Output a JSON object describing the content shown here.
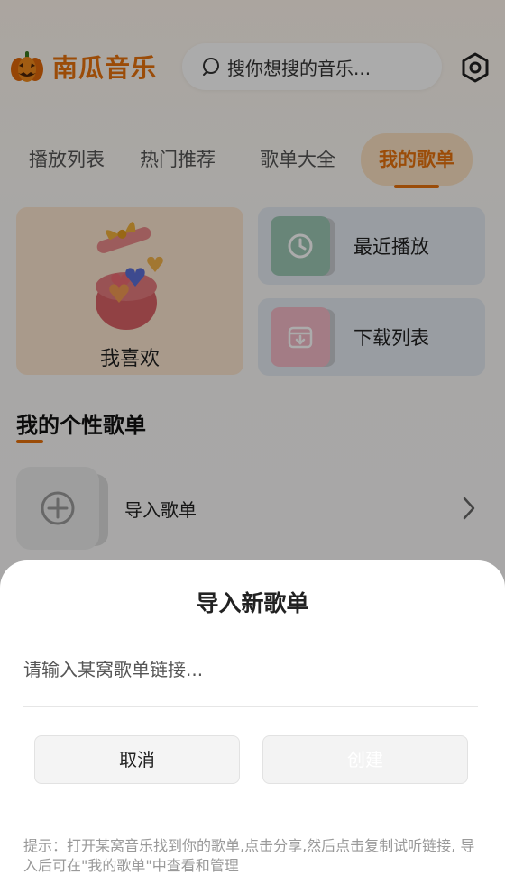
{
  "header": {
    "app_name": "南瓜音乐",
    "search_placeholder": "搜你想搜的音乐...",
    "logo_icon": "pumpkin-icon",
    "settings_icon": "gear-icon"
  },
  "tabs": [
    {
      "label": "播放列表"
    },
    {
      "label": "热门推荐"
    },
    {
      "label": "歌单大全"
    },
    {
      "label": "我的歌单"
    }
  ],
  "cards": {
    "favorites": {
      "label": "我喜欢",
      "icon": "gift-box-hearts-icon"
    },
    "recent": {
      "label": "最近播放",
      "icon": "clock-icon"
    },
    "downloads": {
      "label": "下载列表",
      "icon": "download-box-icon"
    }
  },
  "section": {
    "title": "我的个性歌单",
    "import_label": "导入歌单"
  },
  "dialog": {
    "title": "导入新歌单",
    "input_placeholder": "请输入某窝歌单链接...",
    "cancel_label": "取消",
    "create_label": "创建",
    "hint": "提示：打开某窝音乐找到你的歌单,点击分享,然后点击复制试听链接, 导入后可在\"我的歌单\"中查看和管理"
  },
  "colors": {
    "accent": "#e8720c",
    "overlay": "rgba(0,0,0,0.33)"
  }
}
